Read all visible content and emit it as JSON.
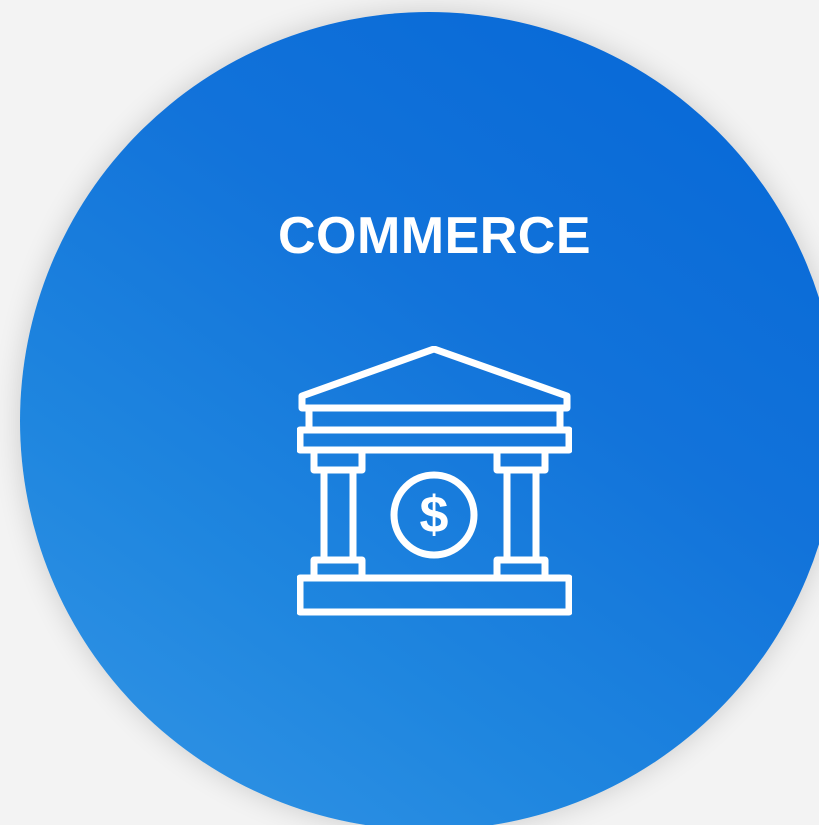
{
  "card": {
    "title": "COMMERCE",
    "icon": "bank-dollar-icon",
    "colors": {
      "gradient_dark": "#0566d6",
      "gradient_light": "#3596e6",
      "foreground": "#ffffff",
      "page_background": "#f3f3f3"
    }
  }
}
